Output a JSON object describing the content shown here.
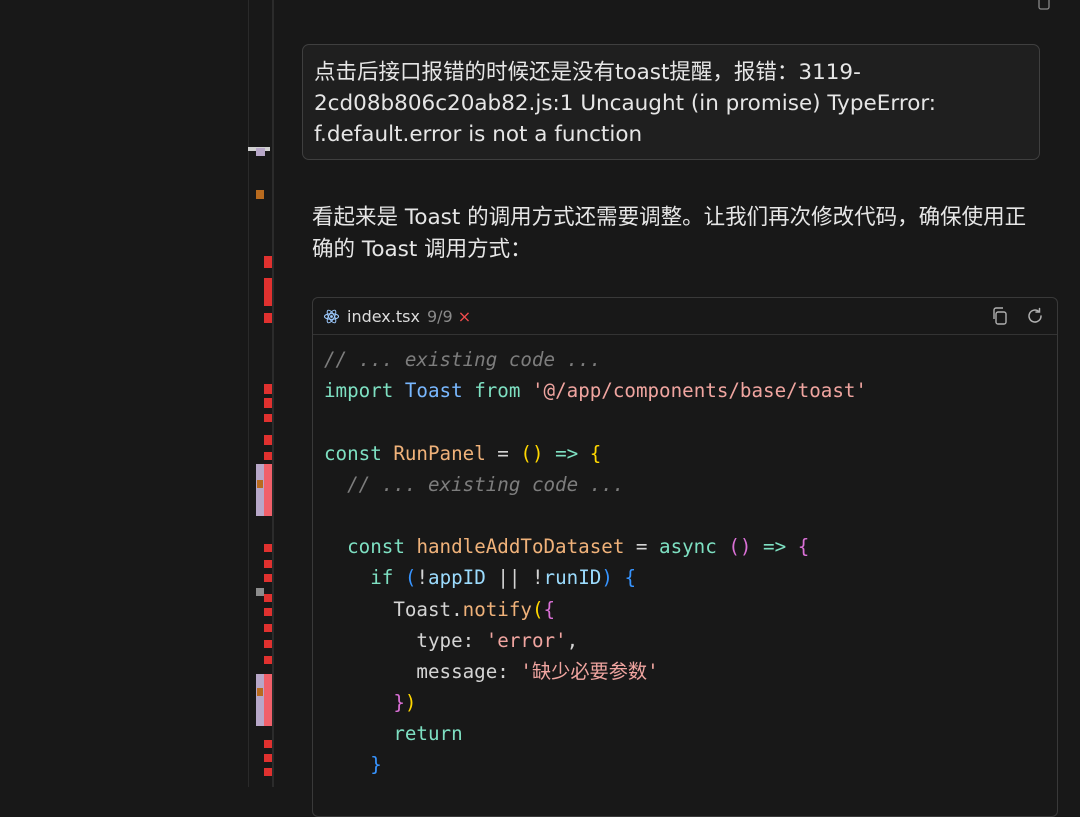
{
  "user_message": {
    "lines": [
      "点击后接口报错的时候还是没有toast提醒，报错：3119-",
      "2cd08b806c20ab82.js:1 Uncaught (in promise) TypeError:",
      "f.default.error is not a function"
    ]
  },
  "assistant_message": {
    "lines": [
      "看起来是 Toast 的调用方式还需要调整。让我们再次修改代码，确保使用正",
      "确的 Toast 调用方式："
    ]
  },
  "code_block": {
    "filename": "index.tsx",
    "changes": "9/9",
    "reject_symbol": "×",
    "lines": [
      {
        "indent": "",
        "tokens": [
          {
            "t": "// ... existing code ...",
            "c": "cm"
          }
        ]
      },
      {
        "indent": "",
        "tokens": [
          {
            "t": "import",
            "c": "kw"
          },
          {
            "t": " ",
            "c": "pr"
          },
          {
            "t": "Toast",
            "c": "ty"
          },
          {
            "t": " ",
            "c": "pr"
          },
          {
            "t": "from",
            "c": "kw"
          },
          {
            "t": " ",
            "c": "pr"
          },
          {
            "t": "'@/app/components/base/toast'",
            "c": "st"
          }
        ]
      },
      {
        "indent": "",
        "tokens": []
      },
      {
        "indent": "",
        "tokens": [
          {
            "t": "const",
            "c": "kw"
          },
          {
            "t": " ",
            "c": "pr"
          },
          {
            "t": "RunPanel",
            "c": "fn"
          },
          {
            "t": " = ",
            "c": "pr"
          },
          {
            "t": "()",
            "c": "b1"
          },
          {
            "t": " => ",
            "c": "kw"
          },
          {
            "t": "{",
            "c": "b1"
          }
        ]
      },
      {
        "indent": "  ",
        "tokens": [
          {
            "t": "// ... existing code ...",
            "c": "cm"
          }
        ]
      },
      {
        "indent": "",
        "tokens": []
      },
      {
        "indent": "  ",
        "tokens": [
          {
            "t": "const",
            "c": "kw"
          },
          {
            "t": " ",
            "c": "pr"
          },
          {
            "t": "handleAddToDataset",
            "c": "fn"
          },
          {
            "t": " = ",
            "c": "pr"
          },
          {
            "t": "async",
            "c": "kw"
          },
          {
            "t": " ",
            "c": "pr"
          },
          {
            "t": "()",
            "c": "b2"
          },
          {
            "t": " => ",
            "c": "kw"
          },
          {
            "t": "{",
            "c": "b2"
          }
        ]
      },
      {
        "indent": "    ",
        "tokens": [
          {
            "t": "if",
            "c": "kw"
          },
          {
            "t": " ",
            "c": "pr"
          },
          {
            "t": "(",
            "c": "b3"
          },
          {
            "t": "!",
            "c": "pr"
          },
          {
            "t": "appID",
            "c": "id"
          },
          {
            "t": " || !",
            "c": "pr"
          },
          {
            "t": "runID",
            "c": "id"
          },
          {
            "t": ")",
            "c": "b3"
          },
          {
            "t": " ",
            "c": "pr"
          },
          {
            "t": "{",
            "c": "b3"
          }
        ]
      },
      {
        "indent": "      ",
        "tokens": [
          {
            "t": "Toast",
            "c": "pr"
          },
          {
            "t": ".",
            "c": "pr"
          },
          {
            "t": "notify",
            "c": "fn"
          },
          {
            "t": "(",
            "c": "b1"
          },
          {
            "t": "{",
            "c": "b2"
          }
        ]
      },
      {
        "indent": "        ",
        "tokens": [
          {
            "t": "type",
            "c": "pr"
          },
          {
            "t": ": ",
            "c": "pr"
          },
          {
            "t": "'error'",
            "c": "st"
          },
          {
            "t": ",",
            "c": "pr"
          }
        ]
      },
      {
        "indent": "        ",
        "tokens": [
          {
            "t": "message",
            "c": "pr"
          },
          {
            "t": ": ",
            "c": "pr"
          },
          {
            "t": "'缺少必要参数'",
            "c": "st"
          }
        ]
      },
      {
        "indent": "      ",
        "tokens": [
          {
            "t": "}",
            "c": "b2"
          },
          {
            "t": ")",
            "c": "b1"
          }
        ]
      },
      {
        "indent": "      ",
        "tokens": [
          {
            "t": "return",
            "c": "kw"
          }
        ]
      },
      {
        "indent": "    ",
        "tokens": [
          {
            "t": "}",
            "c": "b3"
          }
        ]
      }
    ]
  },
  "icons": {
    "copy": "copy-icon",
    "refresh": "refresh-icon",
    "file": "react-icon"
  },
  "colors": {
    "background": "#181818",
    "border": "#3f3f3f",
    "marker_red": "#e0312f",
    "marker_pink": "#f0606a",
    "marker_lavender": "#b7a7c8",
    "marker_orange": "#b86a1e",
    "marker_gray": "#8c8c8c"
  }
}
